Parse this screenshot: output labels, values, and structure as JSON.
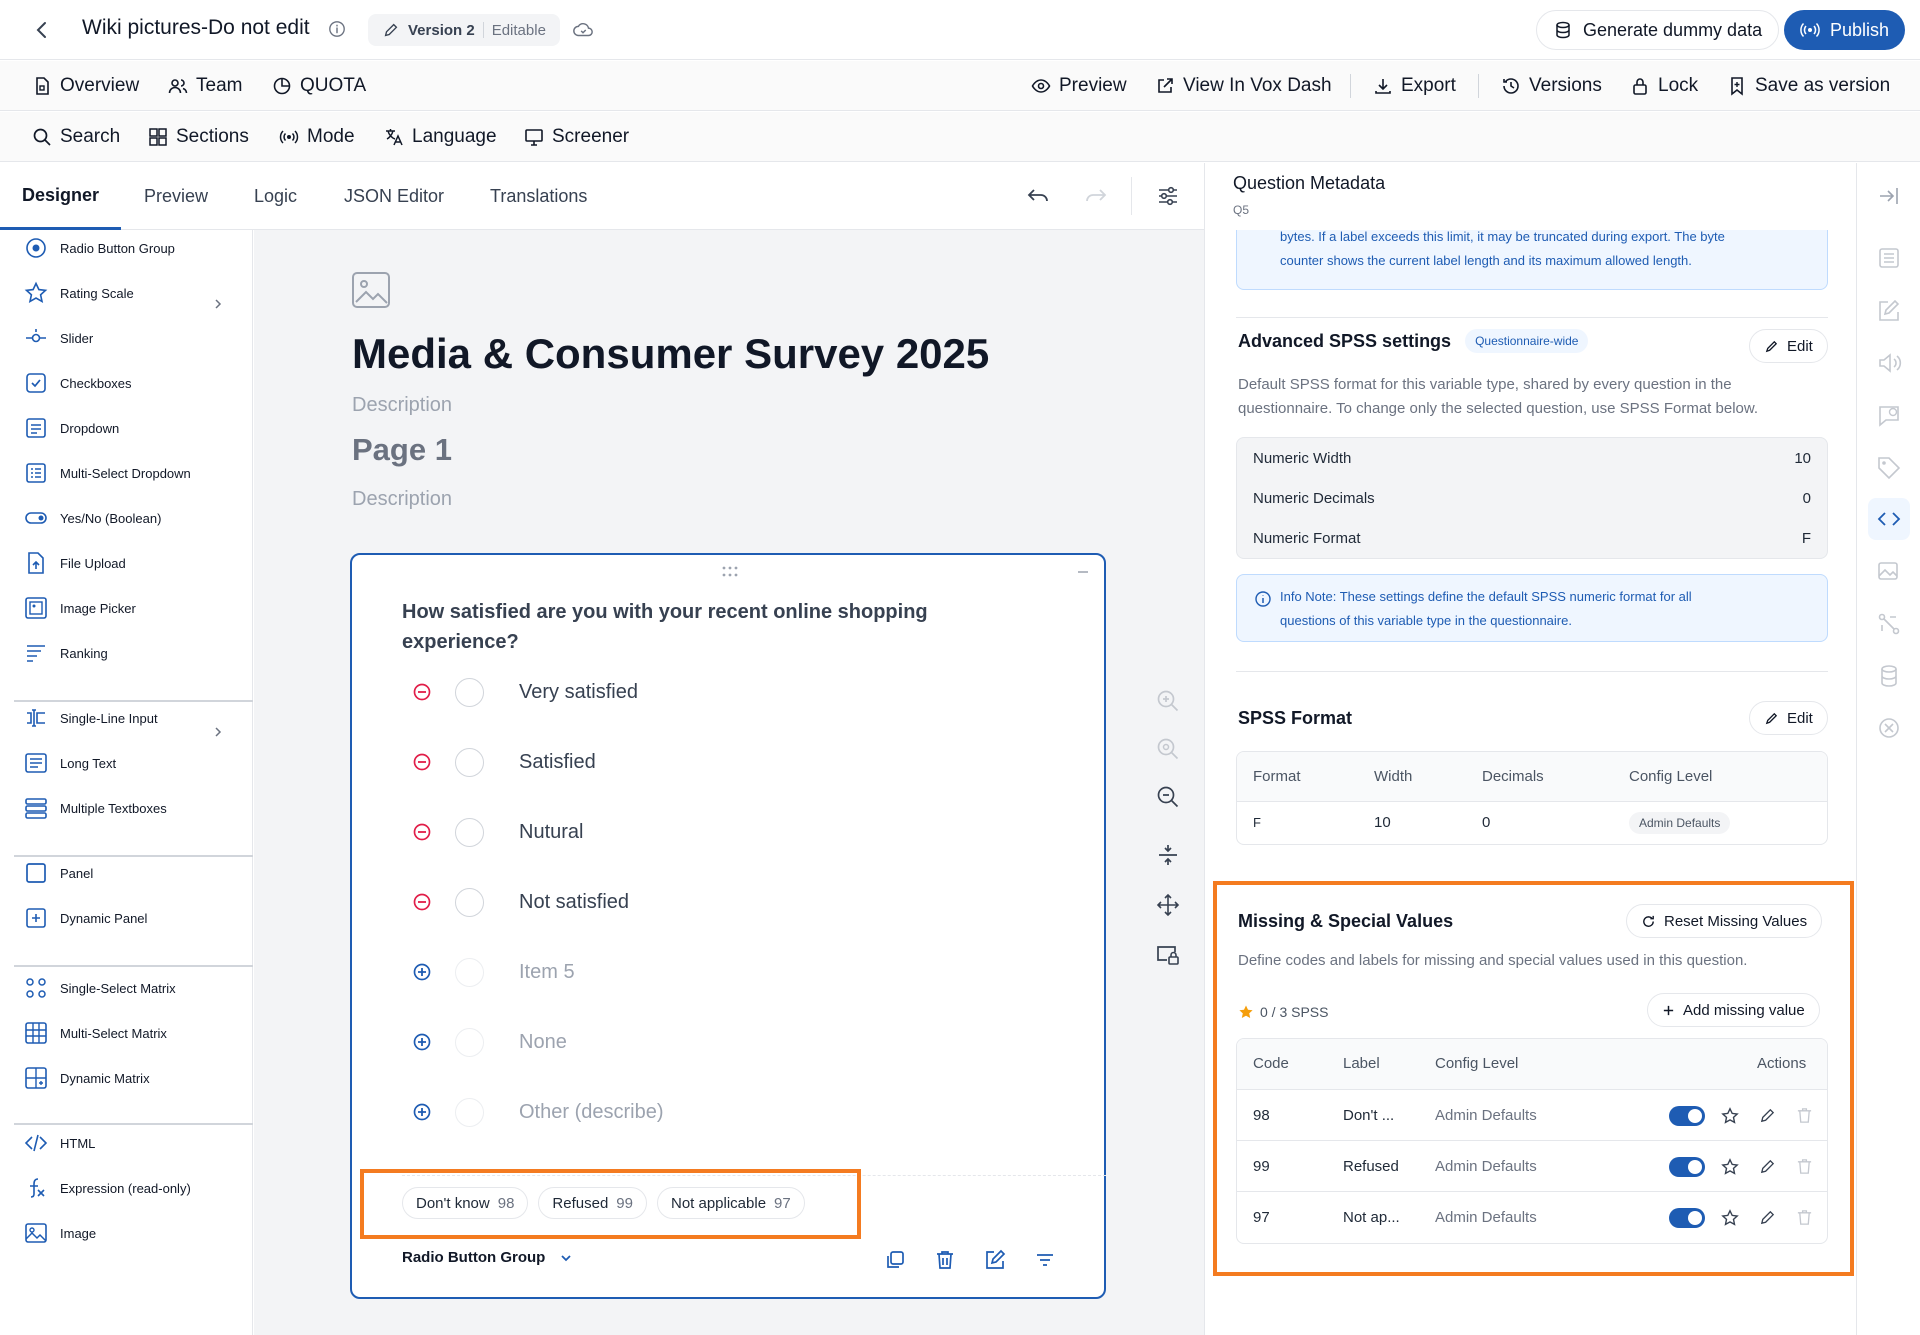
{
  "header": {
    "title": "Wiki pictures-Do not edit",
    "version_label": "Version 2",
    "version_status": "Editable",
    "generate_label": "Generate dummy data",
    "publish_label": "Publish"
  },
  "nav": {
    "left": [
      "Overview",
      "Team",
      "QUOTA"
    ],
    "right": [
      "Preview",
      "View In Vox Dash",
      "Export",
      "Versions",
      "Lock",
      "Save as version"
    ]
  },
  "toolbar": [
    "Search",
    "Sections",
    "Mode",
    "Language",
    "Screener"
  ],
  "designer_tabs": [
    "Designer",
    "Preview",
    "Logic",
    "JSON Editor",
    "Translations"
  ],
  "active_tab": "Designer",
  "toolbox": [
    {
      "label": "Radio Button Group",
      "icon": "radio-icon"
    },
    {
      "label": "Rating Scale",
      "icon": "star-icon"
    },
    {
      "label": "Slider",
      "icon": "slider-icon"
    },
    {
      "label": "Checkboxes",
      "icon": "checkbox-icon"
    },
    {
      "label": "Dropdown",
      "icon": "dropdown-icon"
    },
    {
      "label": "Multi-Select Dropdown",
      "icon": "multi-dropdown-icon"
    },
    {
      "label": "Yes/No (Boolean)",
      "icon": "toggle-icon"
    },
    {
      "label": "File Upload",
      "icon": "file-upload-icon"
    },
    {
      "label": "Image Picker",
      "icon": "image-picker-icon"
    },
    {
      "label": "Ranking",
      "icon": "ranking-icon"
    },
    {
      "label": "Single-Line Input",
      "icon": "text-input-icon"
    },
    {
      "label": "Long Text",
      "icon": "long-text-icon"
    },
    {
      "label": "Multiple Textboxes",
      "icon": "multi-textbox-icon"
    },
    {
      "label": "Panel",
      "icon": "panel-icon"
    },
    {
      "label": "Dynamic Panel",
      "icon": "dynamic-panel-icon"
    },
    {
      "label": "Single-Select Matrix",
      "icon": "matrix-icon"
    },
    {
      "label": "Multi-Select Matrix",
      "icon": "grid-icon"
    },
    {
      "label": "Dynamic Matrix",
      "icon": "dynamic-matrix-icon"
    },
    {
      "label": "HTML",
      "icon": "code-icon"
    },
    {
      "label": "Expression (read-only)",
      "icon": "function-icon"
    },
    {
      "label": "Image",
      "icon": "image-icon"
    }
  ],
  "survey": {
    "title": "Media & Consumer Survey 2025",
    "description": "Description",
    "page_title": "Page 1",
    "page_description": "Description",
    "question": "How satisfied are you with your recent online shopping experience?",
    "choices": [
      {
        "label": "Very satisfied",
        "state": "active"
      },
      {
        "label": "Satisfied",
        "state": "active"
      },
      {
        "label": "Nutural",
        "state": "active"
      },
      {
        "label": "Not satisfied",
        "state": "active"
      },
      {
        "label": "Item 5",
        "state": "placeholder"
      },
      {
        "label": "None",
        "state": "placeholder"
      },
      {
        "label": "Other (describe)",
        "state": "placeholder"
      }
    ],
    "missing_pills": [
      {
        "label": "Don't know",
        "code": "98"
      },
      {
        "label": "Refused",
        "code": "99"
      },
      {
        "label": "Not applicable",
        "code": "97"
      }
    ],
    "question_type": "Radio Button Group"
  },
  "metadata": {
    "title": "Question Metadata",
    "question_id": "Q5",
    "top_note_line1": "bytes. If a label exceeds this limit, it may be truncated during export. The byte",
    "top_note_line2": "counter shows the current label length and its maximum allowed length.",
    "advanced": {
      "title": "Advanced SPSS settings",
      "badge": "Questionnaire-wide",
      "edit_label": "Edit",
      "desc_line1": "Default SPSS format for this variable type, shared by every question in the",
      "desc_line2": "questionnaire. To change only the selected question, use SPSS Format below.",
      "rows": [
        {
          "label": "Numeric Width",
          "value": "10"
        },
        {
          "label": "Numeric Decimals",
          "value": "0"
        },
        {
          "label": "Numeric Format",
          "value": "F"
        }
      ],
      "info_line1": "Info Note: These settings define the default SPSS numeric format for all",
      "info_line2": "questions of this variable type in the questionnaire."
    },
    "spss_format": {
      "title": "SPSS Format",
      "edit_label": "Edit",
      "headers": [
        "Format",
        "Width",
        "Decimals",
        "Config Level"
      ],
      "row": {
        "format": "F",
        "width": "10",
        "decimals": "0",
        "config_level": "Admin Defaults"
      }
    },
    "missing": {
      "title": "Missing & Special Values",
      "reset_label": "Reset Missing Values",
      "desc": "Define codes and labels for missing and special values used in this question.",
      "spss_count": "0 / 3 SPSS",
      "add_label": "Add missing value",
      "headers": [
        "Code",
        "Label",
        "Config Level",
        "Actions"
      ],
      "rows": [
        {
          "code": "98",
          "label": "Don't ...",
          "config_level": "Admin Defaults",
          "enabled": true
        },
        {
          "code": "99",
          "label": "Refused",
          "config_level": "Admin Defaults",
          "enabled": true
        },
        {
          "code": "97",
          "label": "Not ap...",
          "config_level": "Admin Defaults",
          "enabled": true
        }
      ]
    }
  },
  "colors": {
    "primary": "#1e5cb3",
    "highlight": "#f47b20",
    "remove": "#e11d48",
    "info_bg": "#eff6ff",
    "info_text": "#1e5cb3",
    "star": "#f59e0b"
  }
}
